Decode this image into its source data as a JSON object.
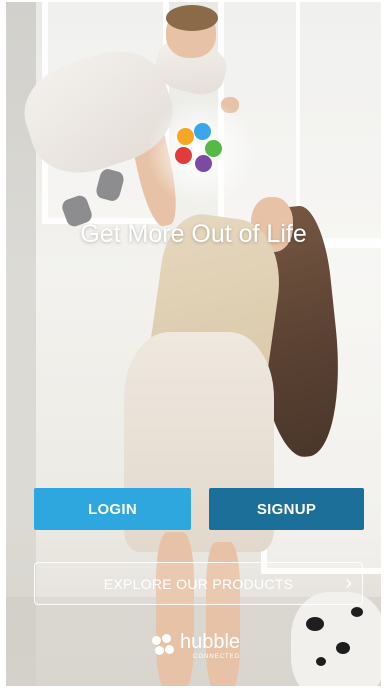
{
  "headline": "Get More Out of Life",
  "buttons": {
    "login": "LOGIN",
    "signup": "SIGNUP",
    "explore": "EXPLORE OUR PRODUCTS"
  },
  "icons": {
    "explore_chevron": "chevron-right-icon",
    "app_logo": "flower-petals-logo",
    "brand_logo": "hubble-logo"
  },
  "brand": {
    "name": "hubble",
    "sub": "CONNECTED"
  },
  "colors": {
    "login": "#2ea7df",
    "signup": "#1c6f99",
    "petal_orange": "#f5a623",
    "petal_blue": "#39a7e8",
    "petal_green": "#56b947",
    "petal_purple": "#7b4aa3",
    "petal_red": "#e23b3b"
  }
}
